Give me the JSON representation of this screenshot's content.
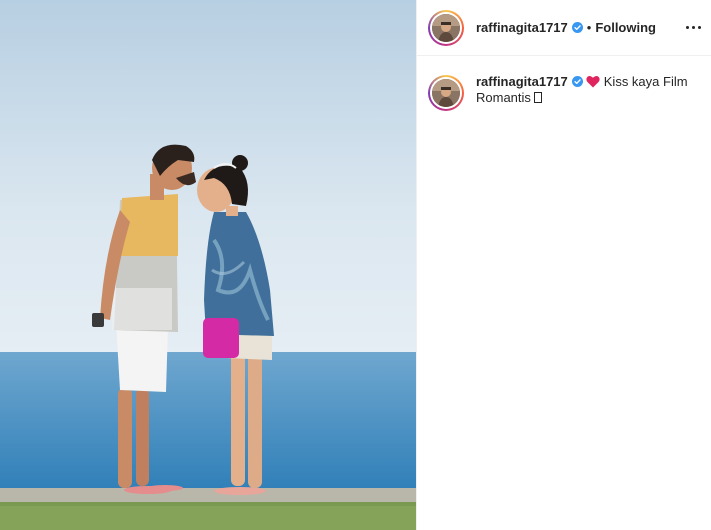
{
  "post": {
    "author": {
      "username": "raffinagita1717",
      "verified": true,
      "follow_status": "Following"
    },
    "separator": "•",
    "caption": {
      "username": "raffinagita1717",
      "emoji": "red-heart",
      "text": "Kiss kaya Film Romantis",
      "trailing_glyph": "missing-glyph-box"
    },
    "image": {
      "description_icon": "photo"
    },
    "colors": {
      "verified_blue": "#3897f0",
      "heart_red": "#e0245e",
      "text": "#262626",
      "border": "#efefef"
    }
  }
}
